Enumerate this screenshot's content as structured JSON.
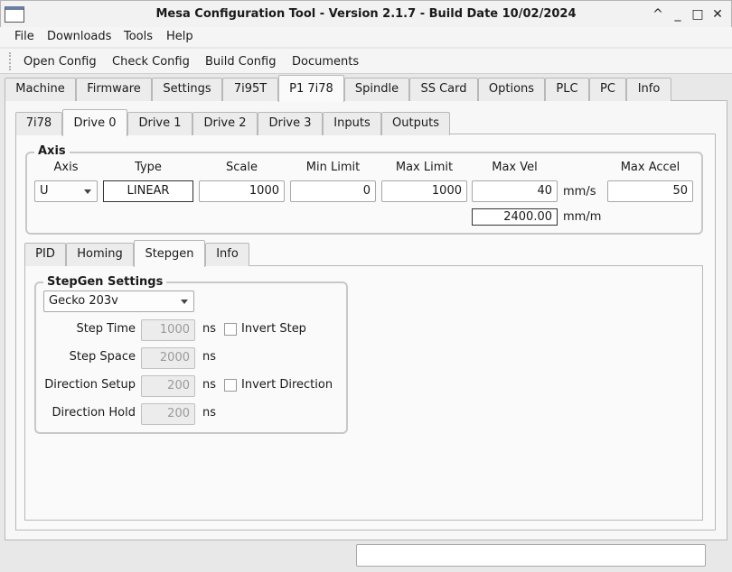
{
  "window": {
    "title": "Mesa Configuration Tool - Version 2.1.7 - Build Date 10/02/2024",
    "controls": [
      "^",
      "_",
      "□",
      "✕"
    ]
  },
  "menu": [
    "File",
    "Downloads",
    "Tools",
    "Help"
  ],
  "toolbar": [
    "Open Config",
    "Check Config",
    "Build Config",
    "Documents"
  ],
  "main_tabs": [
    "Machine",
    "Firmware",
    "Settings",
    "7i95T",
    "P1 7i78",
    "Spindle",
    "SS Card",
    "Options",
    "PLC",
    "PC",
    "Info"
  ],
  "main_tab_active": "P1 7i78",
  "sub_tabs": [
    "7i78",
    "Drive 0",
    "Drive 1",
    "Drive 2",
    "Drive 3",
    "Inputs",
    "Outputs"
  ],
  "sub_tab_active": "Drive 0",
  "axis": {
    "group_title": "Axis",
    "headers": {
      "axis": "Axis",
      "type": "Type",
      "scale": "Scale",
      "min_limit": "Min Limit",
      "max_limit": "Max Limit",
      "max_vel": "Max Vel",
      "max_accel": "Max Accel"
    },
    "axis_value": "U",
    "type_value": "LINEAR",
    "scale_value": "1000",
    "min_limit_value": "0",
    "max_limit_value": "1000",
    "max_vel_value": "40",
    "max_vel_unit": "mm/s",
    "max_vel_mm_value": "2400.00",
    "max_vel_mm_unit": "mm/m",
    "max_accel_value": "50"
  },
  "drive_tabs": [
    "PID",
    "Homing",
    "Stepgen",
    "Info"
  ],
  "drive_tab_active": "Stepgen",
  "stepgen": {
    "group_title": "StepGen Settings",
    "driver": "Gecko 203v",
    "step_time_label": "Step Time",
    "step_time_value": "1000",
    "step_space_label": "Step Space",
    "step_space_value": "2000",
    "dir_setup_label": "Direction Setup",
    "dir_setup_value": "200",
    "dir_hold_label": "Direction Hold",
    "dir_hold_value": "200",
    "unit": "ns",
    "invert_step_label": "Invert Step",
    "invert_dir_label": "Invert Direction"
  },
  "status_text": ""
}
